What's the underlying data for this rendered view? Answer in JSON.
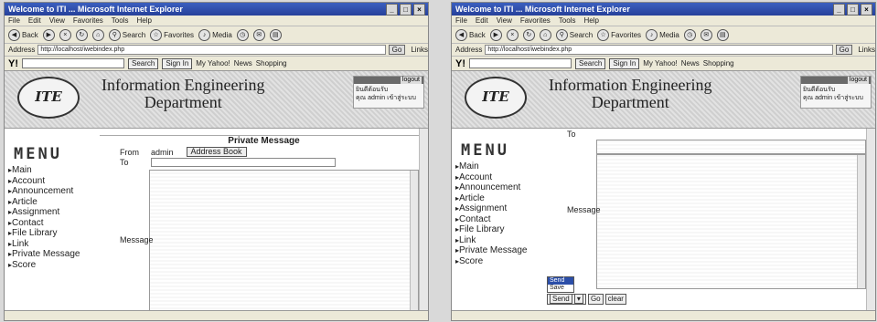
{
  "browser": {
    "title": "Welcome to ITI ...   Microsoft Internet Explorer",
    "menu": [
      "File",
      "Edit",
      "View",
      "Favorites",
      "Tools",
      "Help"
    ],
    "toolbar": {
      "back": "Back",
      "search": "Search",
      "favorites": "Favorites",
      "media": "Media"
    },
    "address_label": "Address",
    "address_value": "http://localhost/iwebindex.php",
    "go_label": "Go",
    "links_label": "Links"
  },
  "yahoo": {
    "logo": "Y!",
    "search_button": "Search",
    "signin_button": "Sign In",
    "my_yahoo": "My Yahoo!",
    "news": "News",
    "shopping": "Shopping"
  },
  "site": {
    "logo_text": "ITE",
    "department_line1": "Information Engineering",
    "department_line2": "Department",
    "user": {
      "logout": "logout",
      "line1": "ยินดีต้อนรับ",
      "line2": "คุณ admin เข้าสู่ระบบ"
    }
  },
  "menu": {
    "title": "MENU",
    "items": [
      "Main",
      "Account",
      "Announcement",
      "Article",
      "Assignment",
      "Contact",
      "File Library",
      "Link",
      "Private Message",
      "Score"
    ]
  },
  "private_message": {
    "title": "Private Message",
    "from_label": "From",
    "from_value": "admin",
    "address_book": "Address Book",
    "to_label": "To",
    "message_label": "Message"
  },
  "compose_controls": {
    "options": [
      "Send",
      "Save"
    ],
    "selected": "Send",
    "go_button": "Go",
    "clear_button": "clear"
  }
}
